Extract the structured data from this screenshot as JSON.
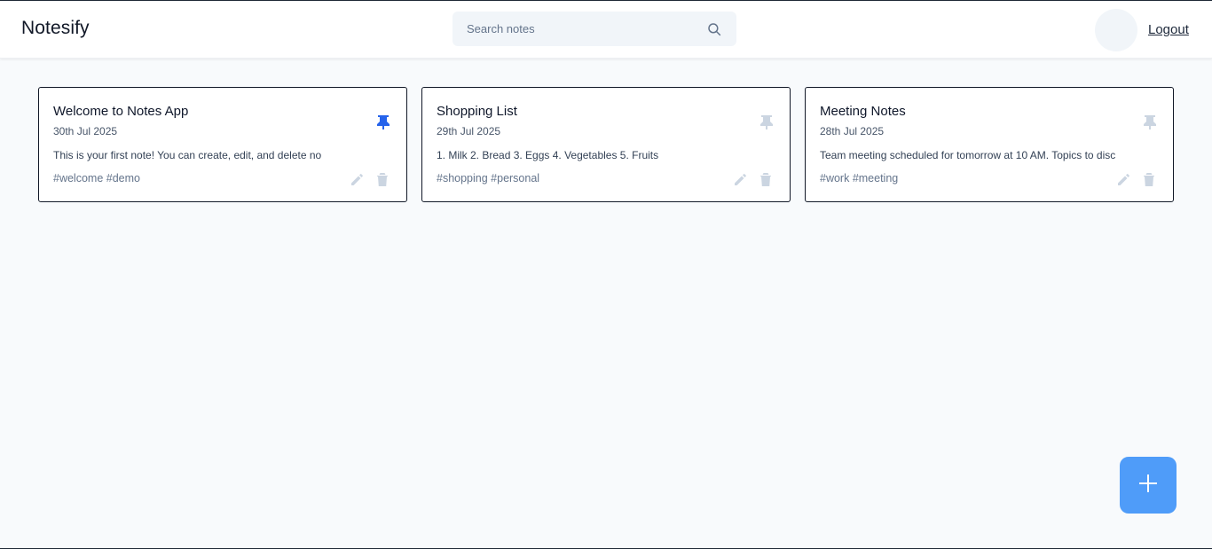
{
  "app": {
    "brand": "Notesify"
  },
  "search": {
    "placeholder": "Search notes",
    "value": "",
    "icon": "search-icon"
  },
  "user": {
    "logout_label": "Logout"
  },
  "colors": {
    "pinned": "#2563eb",
    "unpinned": "#cbd5e1",
    "fab": "#4f9cf9"
  },
  "notes": [
    {
      "title": "Welcome to Notes App",
      "date": "30th Jul 2025",
      "content": "This is your first note! You can create, edit, and delete no",
      "tags": "#welcome #demo",
      "pinned": true
    },
    {
      "title": "Shopping List",
      "date": "29th Jul 2025",
      "content": "1. Milk 2. Bread 3. Eggs 4. Vegetables 5. Fruits",
      "tags": "#shopping #personal",
      "pinned": false
    },
    {
      "title": "Meeting Notes",
      "date": "28th Jul 2025",
      "content": "Team meeting scheduled for tomorrow at 10 AM. Topics to disc",
      "tags": "#work #meeting",
      "pinned": false
    }
  ],
  "fab": {
    "icon": "plus-icon"
  }
}
